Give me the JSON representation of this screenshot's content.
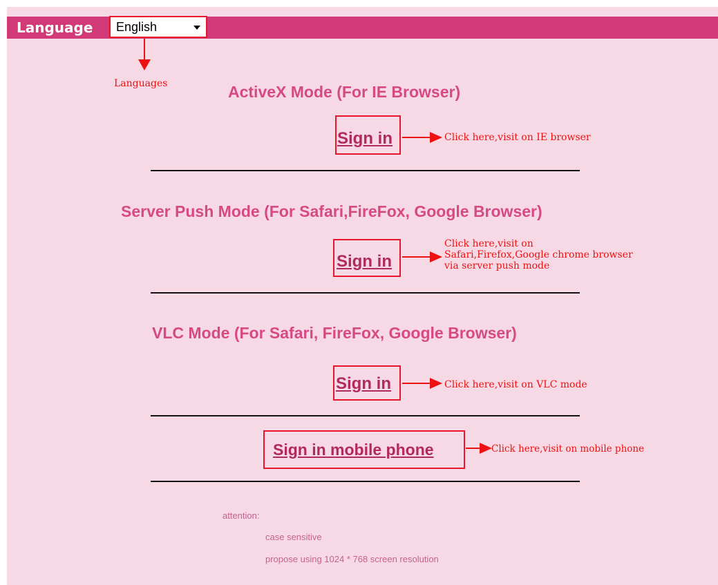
{
  "header": {
    "language_label": "Language",
    "language_value": "English"
  },
  "annotations": {
    "languages": "Languages",
    "ie_note": "Click here,visit on IE browser",
    "push_note": "Click here,visit on\nSafari,Firefox,Google chrome browser\nvia server push mode",
    "vlc_note": "Click here,visit on VLC mode",
    "mobile_note": "Click here,visit on mobile phone"
  },
  "modes": [
    {
      "title": "ActiveX Mode (For IE Browser)",
      "sign_in": "Sign in"
    },
    {
      "title": "Server Push Mode (For Safari,FireFox, Google Browser)",
      "sign_in": "Sign in"
    },
    {
      "title": "VLC Mode (For Safari, FireFox, Google Browser)",
      "sign_in": "Sign in"
    }
  ],
  "mobile": {
    "sign_in": "Sign in mobile phone"
  },
  "footer": {
    "attention": "attention:",
    "case": "case sensitive",
    "resolution": "propose using 1024 * 768 screen resolution"
  },
  "colors": {
    "page_bg": "#f7d8e5",
    "header_bg": "#d13a76",
    "title": "#d64a84",
    "link": "#b02a5e",
    "annotation": "#ee1111"
  }
}
